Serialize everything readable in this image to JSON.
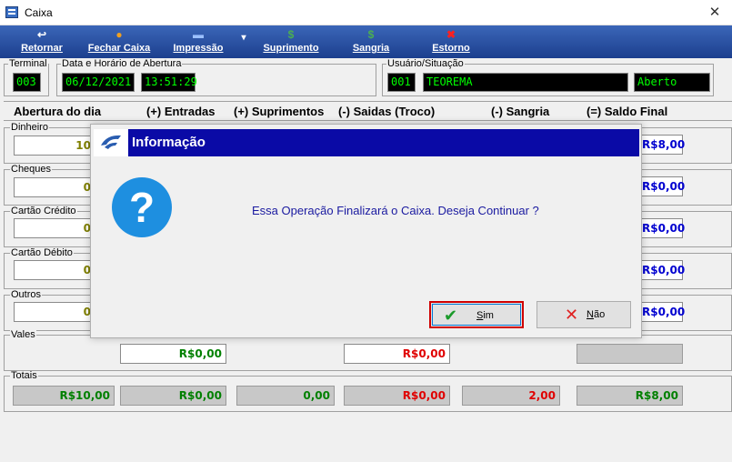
{
  "window": {
    "title": "Caixa",
    "close_glyph": "✕"
  },
  "toolbar": {
    "items": [
      {
        "label": "Retornar",
        "icon": "undo-icon",
        "glyph": "↩"
      },
      {
        "label": "Fechar Caixa",
        "icon": "coins-icon",
        "glyph": "●"
      },
      {
        "label": "Impressão",
        "icon": "printer-icon",
        "glyph": "▬"
      },
      {
        "label": "Suprimento",
        "icon": "money-bag-icon",
        "glyph": "$"
      },
      {
        "label": "Sangria",
        "icon": "money-bag-icon",
        "glyph": "$"
      },
      {
        "label": "Estorno",
        "icon": "red-x-icon",
        "glyph": "✖"
      }
    ],
    "dropdown_glyph": "▾"
  },
  "terminal": {
    "label": "Terminal",
    "value": "003"
  },
  "abertura": {
    "label": "Data e Horário de Abertura",
    "date": "06/12/2021",
    "time": "13:51:29"
  },
  "usuario": {
    "label": "Usuário/Situação",
    "code": "001",
    "name": "TEOREMA",
    "status": "Aberto"
  },
  "headers": [
    "Abertura do dia",
    "(+) Entradas",
    "(+) Suprimentos",
    "(-) Saidas (Troco)",
    "(-) Sangria",
    "(=) Saldo Final"
  ],
  "rows": [
    {
      "label": "Dinheiro",
      "abertura": "10",
      "saldo": "R$8,00"
    },
    {
      "label": "Cheques",
      "abertura": "0",
      "saldo": "R$0,00"
    },
    {
      "label": "Cartão Crédito",
      "abertura": "0",
      "saldo": "R$0,00"
    },
    {
      "label": "Cartão Débito",
      "abertura": "0",
      "saldo": "R$0,00"
    },
    {
      "label": "Outros",
      "abertura": "0",
      "saldo": "R$0,00"
    }
  ],
  "vales": {
    "label": "Vales",
    "entradas": "R$0,00",
    "saidas": "R$0,00",
    "saldo": ""
  },
  "totais": {
    "label": "Totais",
    "values": [
      "R$10,00",
      "R$0,00",
      "0,00",
      "R$0,00",
      "2,00",
      "R$8,00"
    ]
  },
  "colors": {
    "toolbar": "#1c3f8e",
    "led_text": "#00ff00",
    "dialog_title": "#0a0aa6",
    "message": "#1a1aa0"
  },
  "dialog": {
    "title": "Informação",
    "message": "Essa Operação Finalizará o Caixa. Deseja Continuar ?",
    "icon_glyph": "?",
    "yes": {
      "key": "S",
      "rest": "im",
      "glyph": "✔"
    },
    "no": {
      "key": "N",
      "rest": "ão",
      "glyph": "✕"
    }
  }
}
